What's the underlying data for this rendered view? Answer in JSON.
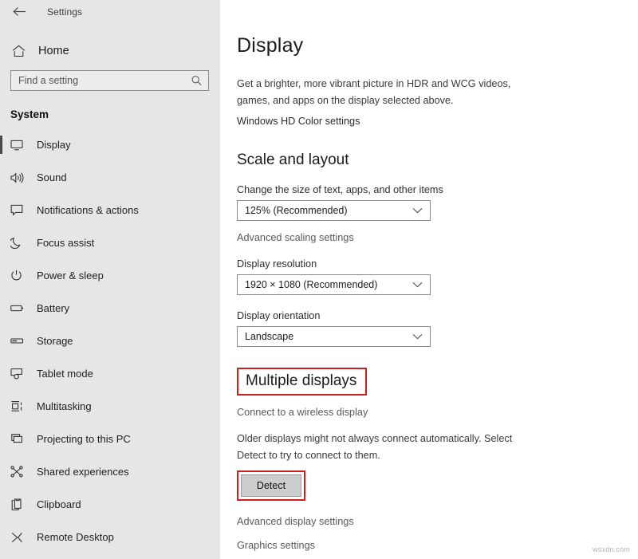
{
  "window": {
    "title": "Settings",
    "back_icon": "back-arrow-icon"
  },
  "sidebar": {
    "home": {
      "label": "Home",
      "icon": "home-icon"
    },
    "search": {
      "placeholder": "Find a setting",
      "value": "",
      "icon": "search-icon"
    },
    "group_title": "System",
    "items": [
      {
        "label": "Display",
        "icon": "monitor-icon",
        "selected": true
      },
      {
        "label": "Sound",
        "icon": "speaker-icon",
        "selected": false
      },
      {
        "label": "Notifications & actions",
        "icon": "notification-icon",
        "selected": false
      },
      {
        "label": "Focus assist",
        "icon": "moon-icon",
        "selected": false
      },
      {
        "label": "Power & sleep",
        "icon": "power-icon",
        "selected": false
      },
      {
        "label": "Battery",
        "icon": "battery-icon",
        "selected": false
      },
      {
        "label": "Storage",
        "icon": "storage-icon",
        "selected": false
      },
      {
        "label": "Tablet mode",
        "icon": "tablet-icon",
        "selected": false
      },
      {
        "label": "Multitasking",
        "icon": "multitasking-icon",
        "selected": false
      },
      {
        "label": "Projecting to this PC",
        "icon": "projecting-icon",
        "selected": false
      },
      {
        "label": "Shared experiences",
        "icon": "share-icon",
        "selected": false
      },
      {
        "label": "Clipboard",
        "icon": "clipboard-icon",
        "selected": false
      },
      {
        "label": "Remote Desktop",
        "icon": "remote-desktop-icon",
        "selected": false
      }
    ]
  },
  "main": {
    "page_title": "Display",
    "hdr_description": "Get a brighter, more vibrant picture in HDR and WCG videos, games, and apps on the display selected above.",
    "hd_color_link": "Windows HD Color settings",
    "scale_section": {
      "title": "Scale and layout",
      "scale_label": "Change the size of text, apps, and other items",
      "scale_value": "125% (Recommended)",
      "advanced_scaling_link": "Advanced scaling settings",
      "resolution_label": "Display resolution",
      "resolution_value": "1920 × 1080 (Recommended)",
      "orientation_label": "Display orientation",
      "orientation_value": "Landscape"
    },
    "multiple_displays": {
      "title": "Multiple displays",
      "wireless_link": "Connect to a wireless display",
      "detect_description": "Older displays might not always connect automatically. Select Detect to try to connect to them.",
      "detect_button": "Detect"
    },
    "footer_links": [
      "Advanced display settings",
      "Graphics settings"
    ]
  },
  "watermark": "wsxdn.com",
  "colors": {
    "sidebar_bg": "#e6e6e6",
    "content_bg": "#ffffff",
    "highlight_red": "#cc1f1f",
    "button_bg": "#cdcdcd",
    "selection_bar": "#4a4a4a"
  }
}
